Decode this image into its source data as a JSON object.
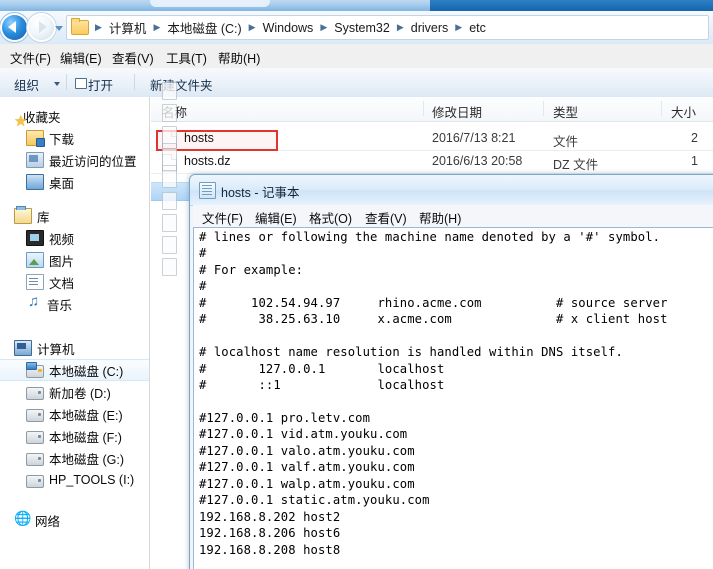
{
  "window": {
    "addressbar": {
      "back_tooltip": "后退",
      "forward_tooltip": "前进",
      "breadcrumbs": [
        "计算机",
        "本地磁盘 (C:)",
        "Windows",
        "System32",
        "drivers",
        "etc"
      ]
    },
    "menubar": [
      "文件(F)",
      "编辑(E)",
      "查看(V)",
      "工具(T)",
      "帮助(H)"
    ],
    "commandbar": {
      "organize": "组织",
      "open": "打开",
      "new_folder": "新建文件夹"
    }
  },
  "navpane": {
    "groups": [
      {
        "header": "收藏夹",
        "icon": "star-icon",
        "items": [
          {
            "label": "下载",
            "icon": "downloads-icon"
          },
          {
            "label": "最近访问的位置",
            "icon": "recent-places-icon"
          },
          {
            "label": "桌面",
            "icon": "desktop-icon"
          }
        ]
      },
      {
        "header": "库",
        "icon": "library-icon",
        "items": [
          {
            "label": "视频",
            "icon": "video-icon"
          },
          {
            "label": "图片",
            "icon": "pictures-icon"
          },
          {
            "label": "文档",
            "icon": "documents-icon"
          },
          {
            "label": "音乐",
            "icon": "music-icon"
          }
        ]
      },
      {
        "header": "计算机",
        "icon": "computer-icon",
        "items": [
          {
            "label": "本地磁盘 (C:)",
            "icon": "system-drive-icon",
            "selected": true
          },
          {
            "label": "新加卷 (D:)",
            "icon": "drive-icon"
          },
          {
            "label": "本地磁盘 (E:)",
            "icon": "drive-icon"
          },
          {
            "label": "本地磁盘 (F:)",
            "icon": "drive-icon"
          },
          {
            "label": "本地磁盘 (G:)",
            "icon": "drive-icon"
          },
          {
            "label": "HP_TOOLS (I:)",
            "icon": "drive-icon"
          }
        ]
      },
      {
        "header": "网络",
        "icon": "network-icon",
        "items": []
      }
    ]
  },
  "filelist": {
    "columns": [
      "名称",
      "修改日期",
      "类型",
      "大小"
    ],
    "rows": [
      {
        "name": "hosts",
        "date": "2016/7/13 8:21",
        "type": "文件",
        "size": "2"
      },
      {
        "name": "hosts.dz",
        "date": "2016/6/13 20:58",
        "type": "DZ 文件",
        "size": "1"
      }
    ],
    "annotation": {
      "shape": "rectangle",
      "color": "#e0342f",
      "target": "hosts"
    }
  },
  "notepad": {
    "title": "hosts - 记事本",
    "menubar": [
      "文件(F)",
      "编辑(E)",
      "格式(O)",
      "查看(V)",
      "帮助(H)"
    ],
    "content": "# lines or following the machine name denoted by a '#' symbol.\n#\n# For example:\n#\n#      102.54.94.97     rhino.acme.com          # source server\n#       38.25.63.10     x.acme.com              # x client host\n\n# localhost name resolution is handled within DNS itself.\n#       127.0.0.1       localhost\n#       ::1             localhost\n\n#127.0.0.1 pro.letv.com\n#127.0.0.1 vid.atm.youku.com\n#127.0.0.1 valo.atm.youku.com\n#127.0.0.1 valf.atm.youku.com\n#127.0.0.1 walp.atm.youku.com\n#127.0.0.1 static.atm.youku.com\n192.168.8.202 host2\n192.168.8.206 host6\n192.168.8.208 host8\n"
  },
  "colors": {
    "annotation_red": "#e0342f",
    "chrome_blue": "#1565b0",
    "selection_blue": "#aed4f5"
  }
}
